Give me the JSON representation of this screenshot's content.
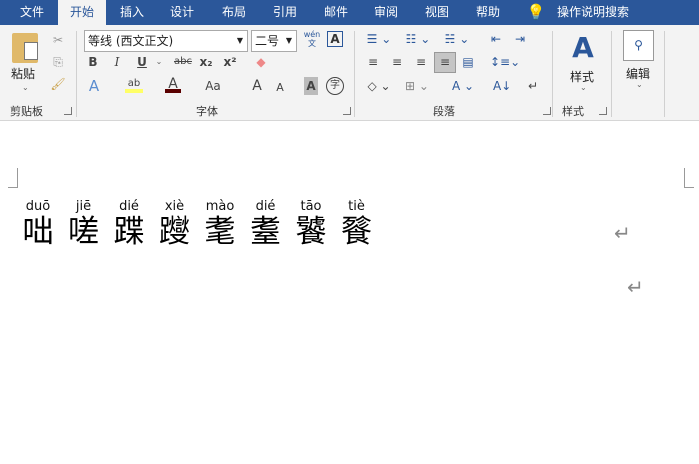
{
  "tabs": [
    "文件",
    "开始",
    "插入",
    "设计",
    "布局",
    "引用",
    "邮件",
    "审阅",
    "视图",
    "帮助"
  ],
  "tell_me": "操作说明搜索",
  "clipboard": {
    "paste": "粘贴",
    "group": "剪贴板"
  },
  "font": {
    "name": "等线 (西文正文)",
    "size": "二号",
    "phonetic_guide": "wén\n文",
    "group": "字体",
    "bold": "B",
    "italic": "I",
    "underline": "U",
    "strike": "abc",
    "sub": "x₂",
    "sup": "x²",
    "effects": "A",
    "highlight": "ab",
    "color": "A",
    "case": "Aa",
    "grow": "A",
    "shrink": "A",
    "shade": "A",
    "enclose": "字"
  },
  "paragraph": {
    "group": "段落"
  },
  "styles": {
    "label": "样式",
    "group": "样式"
  },
  "editing": {
    "label": "编辑"
  },
  "colors": {
    "accent": "#2b579a",
    "font_color": "#5a0000",
    "highlight": "#ffff66"
  },
  "document": {
    "pairs": [
      {
        "py": "duō",
        "hz": "咄"
      },
      {
        "py": "jiē",
        "hz": "嗟"
      },
      {
        "py": "dié",
        "hz": "蹀"
      },
      {
        "py": "xiè",
        "hz": "躞"
      },
      {
        "py": "mào",
        "hz": "耄"
      },
      {
        "py": "dié",
        "hz": "耋"
      },
      {
        "py": "tāo",
        "hz": "饕"
      },
      {
        "py": "tiè",
        "hz": "餮"
      }
    ],
    "para_mark": "↵"
  }
}
